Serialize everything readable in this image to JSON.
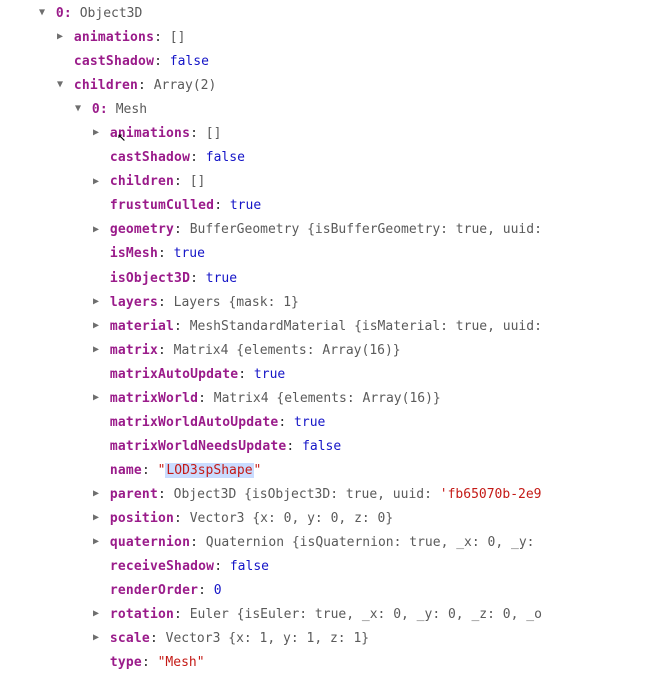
{
  "root": {
    "index": "0:",
    "type": "Object3D"
  },
  "level1": {
    "animations": {
      "key": "animations",
      "val": "[]"
    },
    "castShadow": {
      "key": "castShadow",
      "val": "false"
    },
    "children": {
      "key": "children",
      "val": "Array(2)"
    }
  },
  "child0": {
    "index": "0:",
    "type": "Mesh"
  },
  "props": {
    "animations": {
      "key": "animations",
      "val": "[]"
    },
    "castShadow": {
      "key": "castShadow",
      "val": "false"
    },
    "children": {
      "key": "children",
      "val": "[]"
    },
    "frustumCulled": {
      "key": "frustumCulled",
      "val": "true"
    },
    "geometry": {
      "key": "geometry",
      "val": "BufferGeometry {isBufferGeometry: true, uuid:"
    },
    "isMesh": {
      "key": "isMesh",
      "val": "true"
    },
    "isObject3D": {
      "key": "isObject3D",
      "val": "true"
    },
    "layers": {
      "key": "layers",
      "val": "Layers {mask: 1}"
    },
    "material": {
      "key": "material",
      "val": "MeshStandardMaterial {isMaterial: true, uuid:"
    },
    "matrix": {
      "key": "matrix",
      "val": "Matrix4 {elements: Array(16)}"
    },
    "matrixAutoUpdate": {
      "key": "matrixAutoUpdate",
      "val": "true"
    },
    "matrixWorld": {
      "key": "matrixWorld",
      "val": "Matrix4 {elements: Array(16)}"
    },
    "matrixWorldAutoUpdate": {
      "key": "matrixWorldAutoUpdate",
      "val": "true"
    },
    "matrixWorldNeedsUpdate": {
      "key": "matrixWorldNeedsUpdate",
      "val": "false"
    },
    "name": {
      "key": "name",
      "q": "\"",
      "val": "LOD3spShape"
    },
    "parent": {
      "key": "parent",
      "preview": "Object3D {isObject3D: true, uuid: ",
      "uuid": "'fb65070b-2e9"
    },
    "position": {
      "key": "position",
      "val": "Vector3 {x: 0, y: 0, z: 0}"
    },
    "quaternion": {
      "key": "quaternion",
      "val": "Quaternion {isQuaternion: true, _x: 0, _y:"
    },
    "receiveShadow": {
      "key": "receiveShadow",
      "val": "false"
    },
    "renderOrder": {
      "key": "renderOrder",
      "val": "0"
    },
    "rotation": {
      "key": "rotation",
      "val": "Euler {isEuler: true, _x: 0, _y: 0, _z: 0, _o"
    },
    "scale": {
      "key": "scale",
      "val": "Vector3 {x: 1, y: 1, z: 1}"
    },
    "type": {
      "key": "type",
      "val": "\"Mesh\""
    }
  },
  "glyphs": {
    "open": "▼",
    "closed": "▶"
  }
}
